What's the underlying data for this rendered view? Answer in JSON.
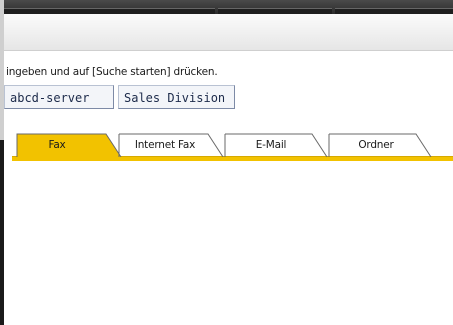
{
  "instruction": "ingeben und auf [Suche starten] drücken.",
  "fields": {
    "server": "abcd-server",
    "division": "Sales Division"
  },
  "tabs": [
    {
      "label": "Fax",
      "selected": true
    },
    {
      "label": "Internet Fax",
      "selected": false
    },
    {
      "label": "E-Mail",
      "selected": false
    },
    {
      "label": "Ordner",
      "selected": false
    }
  ],
  "colors": {
    "active_tab": "#f2c200",
    "tab_border": "#6a6a6a"
  }
}
